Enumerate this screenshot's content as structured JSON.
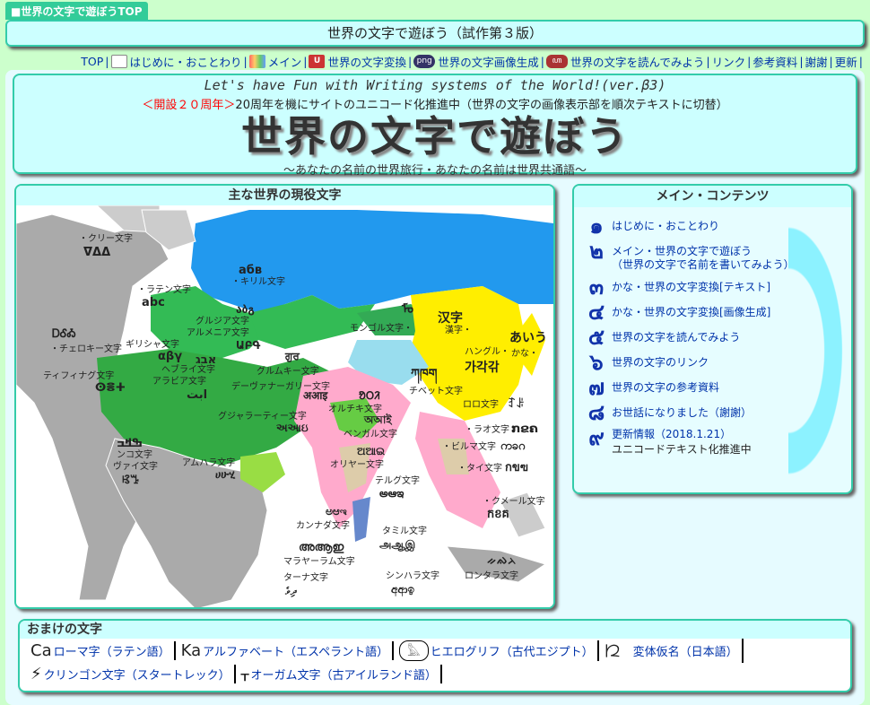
{
  "top_tab": "■世界の文字で遊ぼうTOP",
  "title_bar": "世界の文字で遊ぼう（試作第３版）",
  "nav": [
    {
      "label": "TOP",
      "icon": "none"
    },
    {
      "label": "はじめに・おことわり",
      "icon": "document-icon"
    },
    {
      "label": "メイン",
      "icon": "rainbow-icon"
    },
    {
      "label": "世界の文字変換",
      "icon": "un-icon"
    },
    {
      "label": "世界の文字画像生成",
      "icon": "png-icon"
    },
    {
      "label": "世界の文字を読んでみよう",
      "icon": "script-icon"
    },
    {
      "label": "リンク",
      "icon": "none"
    },
    {
      "label": "参考資料",
      "icon": "none"
    },
    {
      "label": "謝謝",
      "icon": "none"
    },
    {
      "label": "更新",
      "icon": "none"
    }
  ],
  "header": {
    "subtitle": "Let's have Fun with Writing systems of the World!(ver.β3)",
    "notice_red": "＜開設２０周年＞",
    "notice": "20周年を機にサイトのユニコード化推進中（世界の文字の画像表示部を順次テキストに切替）",
    "title": "世界の文字で遊ぼう",
    "tagline": "～あなたの名前の世界旅行・あなたの名前は世界共通語～"
  },
  "map": {
    "heading": "主な世界の現役文字",
    "labels": [
      {
        "text": "・クリー文字",
        "sample": "ᐁᐃᐃ"
      },
      {
        "text": "・ラテン文字",
        "sample": "abc"
      },
      {
        "text": "・チェロキー文字",
        "sample": "ᎠᎴᎣ"
      },
      {
        "text": "ティフィナグ文字",
        "sample": "ⵙⴻⵜ"
      },
      {
        "text": "ギリシャ文字",
        "sample": "αβγ"
      },
      {
        "text": "ヘブライ文字",
        "sample": "אבג"
      },
      {
        "text": "アラビア文字",
        "sample": "ابت"
      },
      {
        "text": "ンコ文字",
        "sample": "ߒߞߏ"
      },
      {
        "text": "ヴァイ文字",
        "sample": "ꕙꔤ"
      },
      {
        "text": "アムハラ文字",
        "sample": "ሀሁሂ"
      },
      {
        "text": "グルジア文字",
        "sample": "აბგ"
      },
      {
        "text": "アルメニア文字",
        "sample": "ԱԲԳ"
      },
      {
        "text": "・キリル文字",
        "sample": "абв"
      },
      {
        "text": "モンゴル文字・",
        "sample": "ᠮᠣ"
      },
      {
        "text": "グルムキー文字",
        "sample": "ਗੁਰ"
      },
      {
        "text": "デーヴァナーガリー文字",
        "sample": "अआइ"
      },
      {
        "text": "グジャラーティー文字",
        "sample": "અઆઇ"
      },
      {
        "text": "オルチキ文字",
        "sample": "ᱚᱛᱤ"
      },
      {
        "text": "ベンガル文字",
        "sample": "অআই"
      },
      {
        "text": "オリヤー文字",
        "sample": "ଅଆଇ"
      },
      {
        "text": "テルグ文字",
        "sample": "అఆఇ"
      },
      {
        "text": "カンナダ文字",
        "sample": "ಅಆಇ"
      },
      {
        "text": "タミル文字",
        "sample": "அஆஇ"
      },
      {
        "text": "マラヤーラム文字",
        "sample": "അആഇ"
      },
      {
        "text": "ターナ文字",
        "sample": "ދިވެ"
      },
      {
        "text": "シンハラ文字",
        "sample": "අආඉ"
      },
      {
        "text": "チベット文字",
        "sample": "ཀཁག"
      },
      {
        "text": "漢字・",
        "sample": "汉字"
      },
      {
        "text": "ハングル・",
        "sample": "가각갂"
      },
      {
        "text": "かな・",
        "sample": "あいう"
      },
      {
        "text": "ロロ文字",
        "sample": "ꆈꌠ"
      },
      {
        "text": "・ラオ文字",
        "sample": "ກຂຄ"
      },
      {
        "text": "・ビルマ文字",
        "sample": "ကခဂ"
      },
      {
        "text": "・タイ文字",
        "sample": "กขฃ"
      },
      {
        "text": "・クメール文字",
        "sample": "កខគ"
      },
      {
        "text": "ロンタラ文字",
        "sample": "ᨀᨁᨂ"
      }
    ]
  },
  "contents": {
    "heading": "メイン・コンテンツ",
    "items": [
      {
        "num": "๑",
        "label": "はじめに・おことわり",
        "link": true
      },
      {
        "num": "๒",
        "label": "メイン・世界の文字で遊ぼう\n（世界の文字で名前を書いてみよう）",
        "link": true
      },
      {
        "num": "๓",
        "label": "かな・世界の文字変換[テキスト]",
        "link": true
      },
      {
        "num": "๔",
        "label": "かな・世界の文字変換[画像生成]",
        "link": true
      },
      {
        "num": "๕",
        "label": "世界の文字を読んでみよう",
        "link": true
      },
      {
        "num": "๖",
        "label": "世界の文字のリンク",
        "link": true
      },
      {
        "num": "๗",
        "label": "世界の文字の参考資料",
        "link": true
      },
      {
        "num": "๘",
        "label": "お世話になりました（謝謝）",
        "link": true
      },
      {
        "num": "๙",
        "label": "更新情報（2018.1.21）",
        "link": true,
        "sub": "ユニコードテキスト化推進中"
      }
    ]
  },
  "extras": {
    "heading": "おまけの文字",
    "row1": [
      {
        "glyph": "Ca",
        "label": "ローマ字（ラテン語）"
      },
      {
        "glyph": "Ka",
        "label": "アルファベート（エスペラント語）"
      },
      {
        "glyph": "𓅓",
        "label": "ヒエログリフ（古代エジプト）"
      },
      {
        "glyph": "𛀁",
        "label": "変体仮名（日本語）"
      }
    ],
    "row2": [
      {
        "glyph": "⚡",
        "label": "クリンゴン文字（スタートレック）"
      },
      {
        "glyph": "ᚁ",
        "label": "オーガム文字（古アイルランド語）"
      }
    ]
  },
  "colors": {
    "page_bg": "#ccffcc",
    "panel_border": "#33ccaa",
    "panel_bg": "#ccffff",
    "link": "#0033aa",
    "notice_red": "#ff0000"
  }
}
